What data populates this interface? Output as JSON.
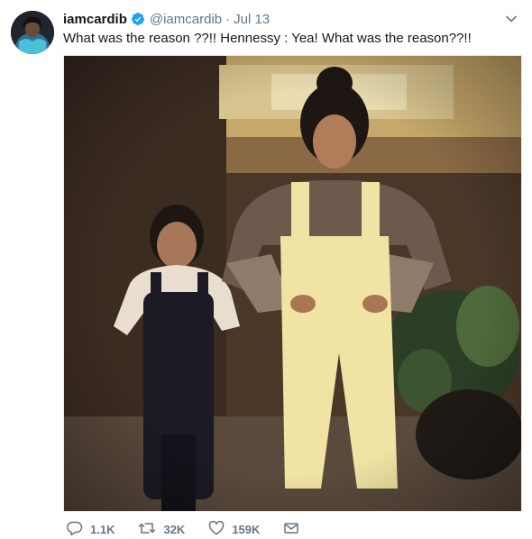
{
  "tweet": {
    "display_name": "iamcardib",
    "handle": "@iamcardib",
    "separator": "·",
    "date": "Jul 13",
    "text": "What was the reason ??!! Hennessy : Yea! What was the reason??!!",
    "verified": true,
    "icons": {
      "verified": "verified-badge-icon",
      "more": "chevron-down-icon",
      "reply": "reply-icon",
      "retweet": "retweet-icon",
      "like": "heart-icon",
      "dm": "envelope-icon"
    },
    "actions": {
      "reply_count": "1.1K",
      "retweet_count": "32K",
      "like_count": "159K"
    }
  },
  "colors": {
    "accent": "#1da1f2",
    "muted": "#657786",
    "text": "#14171a"
  }
}
